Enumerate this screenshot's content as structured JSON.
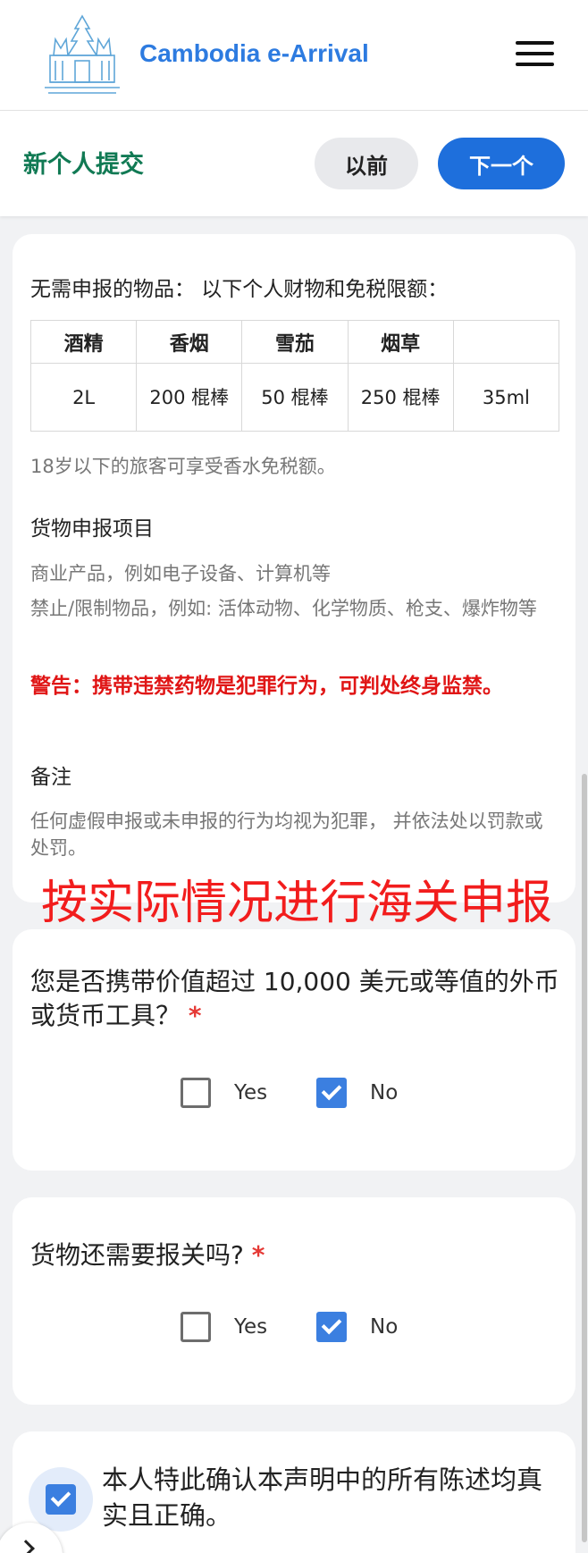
{
  "header": {
    "brand": "Cambodia e-Arrival",
    "logo_icon": "angkor-temple-logo-icon",
    "menu_icon": "hamburger-menu-icon"
  },
  "subheader": {
    "title": "新个人提交",
    "prev_label": "以前",
    "next_label": "下一个"
  },
  "customs_info": {
    "intro": "无需申报的物品： 以下个人财物和免税限额：",
    "table": {
      "headers": [
        "酒精",
        "香烟",
        "雪茄",
        "烟草",
        ""
      ],
      "row": [
        "2L",
        "200 棍棒",
        "50 棍棒",
        "250 棍棒",
        "35ml"
      ]
    },
    "perfume_note": "18岁以下的旅客可享受香水免税额。",
    "goods_heading": "货物申报项目",
    "goods_item1": "商业产品，例如电子设备、计算机等",
    "goods_item2": "禁止/限制物品，例如: 活体动物、化学物质、枪支、爆炸物等",
    "warning": "警告：携带违禁药物是犯罪行为，可判处终身监禁。",
    "remarks_heading": "备注",
    "remarks_text": "任何虚假申报或未申报的行为均视为犯罪， 并依法处以罚款或处罚。"
  },
  "overlay_caption": "按实际情况进行海关申报",
  "question_currency": {
    "text": "您是否携带价值超过 10,000 美元或等值的外币或货币工具？",
    "required_mark": "*",
    "yes_label": "Yes",
    "no_label": "No",
    "selected": "No"
  },
  "question_goods": {
    "text": "货物还需要报关吗?",
    "required_mark": "*",
    "yes_label": "Yes",
    "no_label": "No",
    "selected": "No"
  },
  "confirmation": {
    "text": "本人特此确认本声明中的所有陈述均真实且正确。",
    "checked": true
  },
  "colors": {
    "brand_blue": "#2d7be0",
    "title_green": "#117a54",
    "primary_button": "#1e6fdc",
    "warning_red": "#e01515",
    "checkbox_blue": "#3b7fe0"
  }
}
